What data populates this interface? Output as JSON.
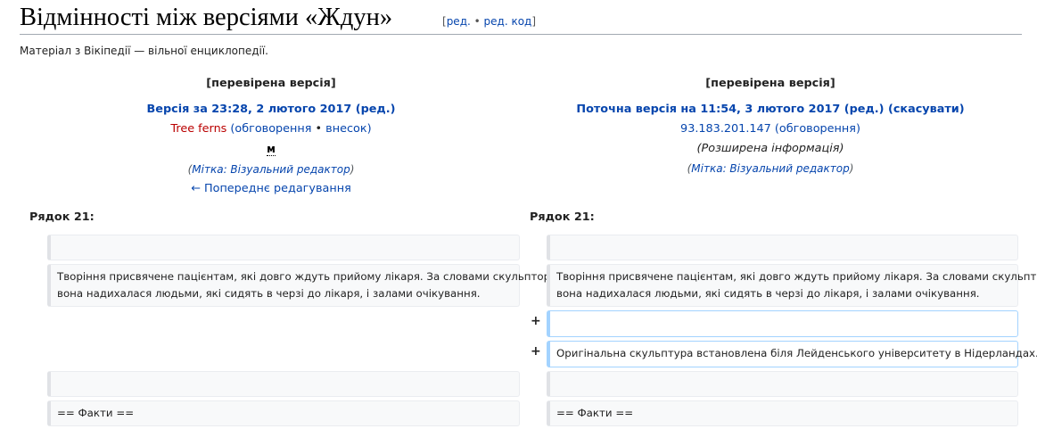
{
  "page": {
    "title": "Відмінності між версіями «Ждун»",
    "edit_open": "[",
    "edit_label": "ред.",
    "edit_sep": " • ",
    "edit_source_label": "ред. код",
    "edit_close": "]",
    "site_sub": "Матеріал з Вікіпедії — вільної енциклопедії."
  },
  "left": {
    "status": "[перевірена версія]",
    "version_link": "Версія за 23:28, 2 лютого 2017",
    "version_edit": "(ред.)",
    "user": "Tree ferns",
    "user_tools_open": " (",
    "talk": "обговорення",
    "sep": " • ",
    "contribs": "внесок",
    "user_tools_close": ")",
    "minor": "м",
    "tag_open": "(",
    "tag": "Мітка: Візуальний редактор",
    "tag_close": ")",
    "prev_edit": "← Попереднє редагування"
  },
  "right": {
    "status": "[перевірена версія]",
    "version_link": "Поточна версія на 11:54, 3 лютого 2017",
    "version_edit": "(ред.)",
    "undo": "(скасувати)",
    "user": "93.183.201.147",
    "talk": "(обговорення)",
    "extended": "(Розширена інформація)",
    "tag_open": "(",
    "tag": "Мітка: Візуальний редактор",
    "tag_close": ")"
  },
  "diff": {
    "line_left": "Рядок 21:",
    "line_right": "Рядок 21:",
    "context_text_line1": "Творіння присвячене пацієнтам, які довго ждуть прийому лікаря. За словами скульптора,",
    "context_text_line2": "вона надихалася людьми, які сидять в черзі до лікаря, і залами очікування.",
    "added_marker": "+",
    "added_blank": "",
    "added_text": "Оригінальна скульптура встановлена біля Лейденського університету в Нідерландах.",
    "facts": "== Факти =="
  }
}
